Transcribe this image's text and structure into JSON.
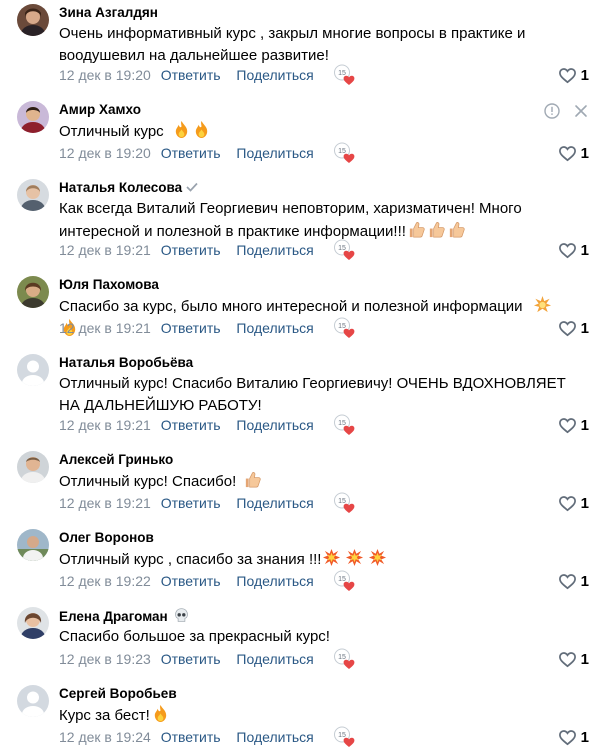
{
  "ui": {
    "reply_label": "Ответить",
    "share_label": "Поделиться",
    "reaction_count": "15",
    "like_icon": "heart-outline-icon",
    "reaction_icon": "reaction-heart-icon",
    "accent_link": "#2a5885",
    "meta_color": "#818c99"
  },
  "comments": [
    {
      "author": "Зина Азгалдян",
      "text": "Очень информативный курс , закрыл многие вопросы в практике и воодушевил на дальнейшее развитие!",
      "date": "12 дек в 19:20",
      "likes": "1"
    },
    {
      "author": "Амир Хамхо",
      "text": "Отличный курс",
      "date": "12 дек в 19:20",
      "likes": "1"
    },
    {
      "author": "Наталья Колесова",
      "text": "Как всегда Виталий Георгиевич неповторим, харизматичен! Много интересной и полезной в практике информации!!!",
      "date": "12 дек в 19:21",
      "likes": "1"
    },
    {
      "author": "Юля Пахомова",
      "text": "Спасибо за курс, было много интересной и полезной информации",
      "date": "12 дек в 19:21",
      "likes": "1"
    },
    {
      "author": "Наталья Воробьёва",
      "text": "Отличный курс! Спасибо Виталию Георгиевичу! ОЧЕНЬ ВДОХНОВЛЯЕТ НА ДАЛЬНЕЙШУЮ РАБОТУ!",
      "date": "12 дек в 19:21",
      "likes": "1"
    },
    {
      "author": "Алексей Гринько",
      "text": "Отличный курс! Спасибо!",
      "date": "12 дек в 19:21",
      "likes": "1"
    },
    {
      "author": "Олег Воронов",
      "text": "Отличный курс , спасибо за знания !!!",
      "date": "12 дек в 19:22",
      "likes": "1"
    },
    {
      "author": "Елена Драгоман",
      "text": "Спасибо большое за прекрасный курс!",
      "date": "12 дек в 19:23",
      "likes": "1"
    },
    {
      "author": "Сергей Воробьев",
      "text": "Курс за бест!",
      "date": "12 дек в 19:24",
      "likes": "1"
    }
  ]
}
